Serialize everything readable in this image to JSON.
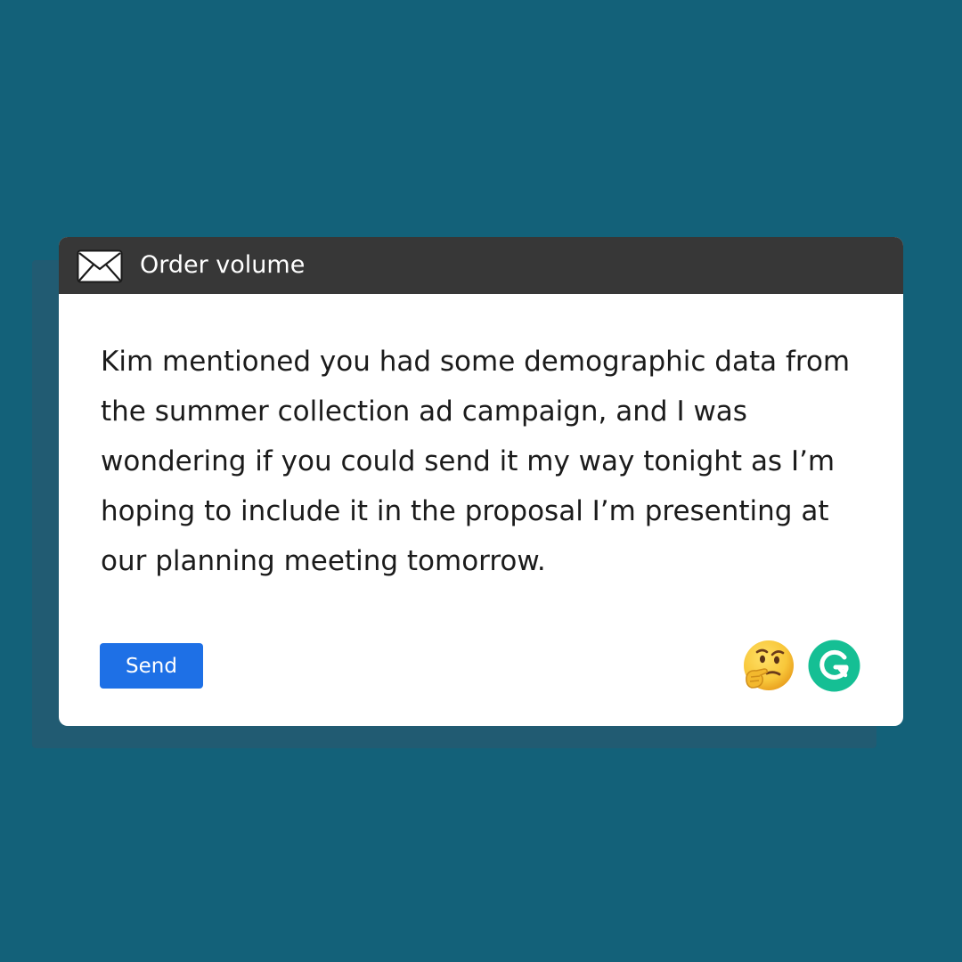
{
  "window": {
    "title": "Order volume",
    "icon": "envelope-icon"
  },
  "message": {
    "body": "Kim mentioned you had some demographic data from the summer collection ad campaign, and I was wondering if you could send it my way tonight as I’m hoping to include it in the proposal I’m presenting at our planning meeting tomorrow."
  },
  "actions": {
    "send_label": "Send"
  },
  "icons": {
    "mood": "thinking-face-emoji",
    "assistant": "grammarly-g-icon"
  },
  "colors": {
    "background": "#136179",
    "titlebar": "#373737",
    "send_button": "#1e70e6",
    "assistant": "#15bf94"
  }
}
